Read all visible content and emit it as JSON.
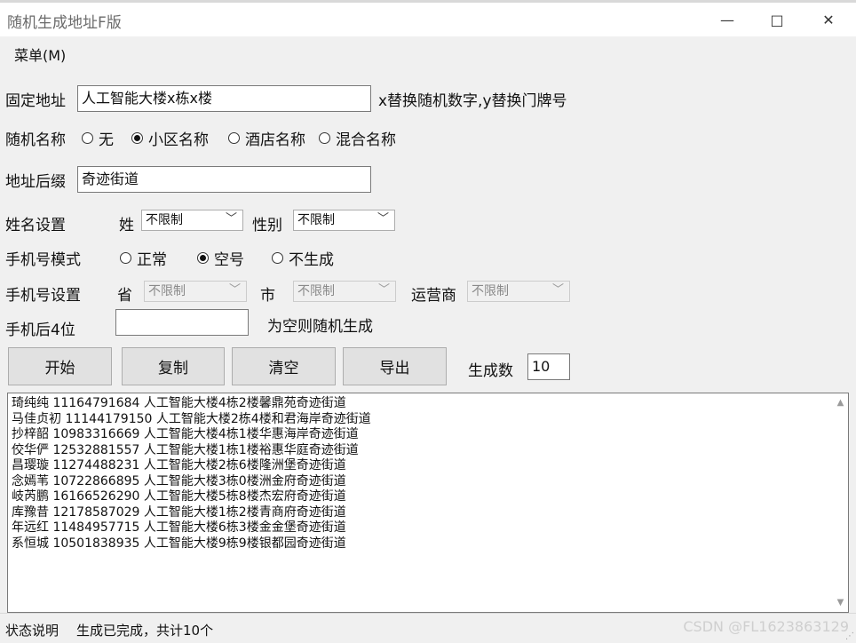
{
  "window": {
    "title": "随机生成地址F版",
    "minimize": "—",
    "maximize": "□",
    "close": "✕"
  },
  "menu": {
    "label": "菜单(M)"
  },
  "fixed_address": {
    "label": "固定地址",
    "value": "人工智能大楼x栋x楼",
    "hint": "x替换随机数字,y替换门牌号"
  },
  "random_name": {
    "label": "随机名称",
    "options": [
      "无",
      "小区名称",
      "酒店名称",
      "混合名称"
    ],
    "selected": "小区名称"
  },
  "suffix": {
    "label": "地址后缀",
    "value": "奇迹街道"
  },
  "name_settings": {
    "label": "姓名设置",
    "surname_label": "姓",
    "surname_value": "不限制",
    "gender_label": "性别",
    "gender_value": "不限制"
  },
  "phone_mode": {
    "label": "手机号模式",
    "options": [
      "正常",
      "空号",
      "不生成"
    ],
    "selected": "空号"
  },
  "phone_settings": {
    "label": "手机号设置",
    "province_label": "省",
    "province_value": "不限制",
    "city_label": "市",
    "city_value": "不限制",
    "carrier_label": "运营商",
    "carrier_value": "不限制"
  },
  "phone_last4": {
    "label": "手机后4位",
    "value": "",
    "hint": "为空则随机生成"
  },
  "buttons": {
    "start": "开始",
    "copy": "复制",
    "clear": "清空",
    "export": "导出"
  },
  "count": {
    "label": "生成数",
    "value": "10"
  },
  "output_lines": [
    "琦纯纯 11164791684 人工智能大楼4栋2楼馨鼎苑奇迹街道",
    "马佳贞初 11144179150 人工智能大楼2栋4楼和君海岸奇迹街道",
    "抄梓韶 10983316669 人工智能大楼4栋1楼华惠海岸奇迹街道",
    "佼华俨 12532881557 人工智能大楼1栋1楼裕惠华庭奇迹街道",
    "昌璎璇 11274488231 人工智能大楼2栋6楼隆洲堡奇迹街道",
    "念嫣苇 10722866895 人工智能大楼3栋0楼洲金府奇迹街道",
    "岐芮鹏 16166526290 人工智能大楼5栋8楼杰宏府奇迹街道",
    "库豫昔 12178587029 人工智能大楼1栋2楼青商府奇迹街道",
    "年远红 11484957715 人工智能大楼6栋3楼金金堡奇迹街道",
    "系恒城 10501838935 人工智能大楼9栋9楼银都园奇迹街道"
  ],
  "status": {
    "label": "状态说明",
    "text": "生成已完成，共计10个",
    "watermark": "CSDN @FL1623863129"
  }
}
